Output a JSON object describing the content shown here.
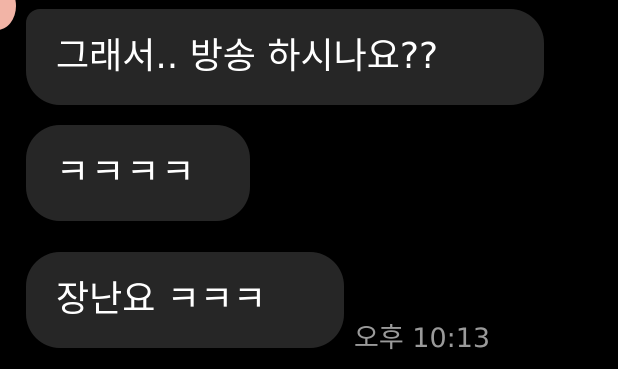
{
  "messages": [
    {
      "text": "그래서.. 방송 하시나요??"
    },
    {
      "text": "ㅋㅋㅋㅋ"
    },
    {
      "text": "장난요 ㅋㅋㅋ"
    }
  ],
  "timestamp": "오후 10:13",
  "colors": {
    "background": "#000000",
    "bubble": "#262626",
    "text": "#ffffff",
    "timestamp": "#9a9a9a",
    "avatar": "#f2b4a6"
  }
}
